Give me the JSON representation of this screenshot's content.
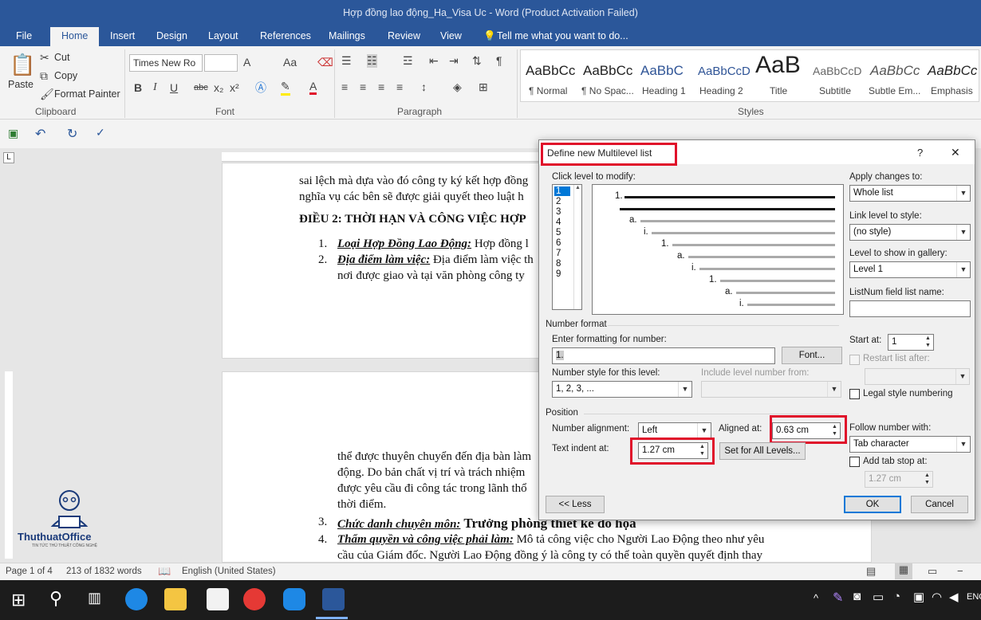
{
  "window": {
    "title": "Hợp đồng lao động_Ha_Visa Uc - Word (Product Activation Failed)"
  },
  "tabs": [
    "File",
    "Home",
    "Insert",
    "Design",
    "Layout",
    "References",
    "Mailings",
    "Review",
    "View"
  ],
  "tell_me": "Tell me what you want to do...",
  "clipboard": {
    "paste": "Paste",
    "cut": "Cut",
    "copy": "Copy",
    "format_painter": "Format Painter",
    "label": "Clipboard"
  },
  "font": {
    "name": "Times New Ro",
    "size": "",
    "label": "Font",
    "bold": "B",
    "italic": "I",
    "underline": "U",
    "strike": "abc",
    "sub": "x₂",
    "sup": "x²",
    "font_color": "A",
    "grow": "A",
    "case": "Aa"
  },
  "paragraph": {
    "label": "Paragraph"
  },
  "styles": {
    "label": "Styles",
    "items": [
      {
        "preview": "AaBbCc",
        "name": "¶ Normal"
      },
      {
        "preview": "AaBbCc",
        "name": "¶ No Spac..."
      },
      {
        "preview": "AaBbC",
        "name": "Heading 1"
      },
      {
        "preview": "AaBbCcD",
        "name": "Heading 2"
      },
      {
        "preview": "AaB",
        "name": "Title"
      },
      {
        "preview": "AaBbCcD",
        "name": "Subtitle"
      },
      {
        "preview": "AaBbCc",
        "name": "Subtle Em..."
      },
      {
        "preview": "AaBbCc",
        "name": "Emphasis"
      }
    ]
  },
  "doc": {
    "page1": [
      "sai lệch mà dựa vào đó công ty ký kết hợp đồng",
      "nghĩa vụ các bên sẽ được giải quyết theo luật h"
    ],
    "heading": "ĐIỀU 2: THỜI HẠN VÀ CÔNG VIỆC HỢP",
    "item1_num": "1.",
    "item1_label": "Loại Hợp Đồng Lao Động:",
    "item1_text": " Hợp đồng l",
    "item2_num": "2.",
    "item2_label": "Địa điểm làm việc:",
    "item2_text": " Địa điểm làm việc th",
    "item2_cont": "nơi được giao và tại văn phòng công ty",
    "page2": [
      "thể được thuyên chuyển đến địa bàn làm",
      "động. Do bản chất vị trí và trách nhiệm",
      "được yêu cầu đi công tác trong lãnh thổ",
      "thời điểm."
    ],
    "item3_num": "3.",
    "item3_label": "Chức danh chuyên môn:",
    "item3_text": " Trưởng phòng thiết kế đồ họa",
    "item4_num": "4.",
    "item4_label": "Thẩm quyền và công việc phải làm:",
    "item4_text": " Mô tả công việc cho Người Lao Động theo như yêu",
    "item4_cont": "cầu của Giám đốc. Người Lao Động đồng ý là công ty có thể toàn quyền quyết định thay"
  },
  "watermark": {
    "brand": "ThuthuatOffice",
    "tag": "TIN TỨC THỦ THUẬT CÔNG NGHỆ"
  },
  "status": {
    "page": "Page 1 of 4",
    "words": "213 of 1832 words",
    "language": "English (United States)"
  },
  "taskbar": {
    "lang": "ENG"
  },
  "dialog": {
    "title": "Define new Multilevel list",
    "help": "?",
    "close": "✕",
    "click_level": "Click level to modify:",
    "levels": [
      "1",
      "2",
      "3",
      "4",
      "5",
      "6",
      "7",
      "8",
      "9"
    ],
    "preview_labels": [
      "1.",
      "a.",
      "i.",
      "1.",
      "a.",
      "i.",
      "1.",
      "a.",
      "i."
    ],
    "apply_to_label": "Apply changes to:",
    "apply_to": "Whole list",
    "link_style_label": "Link level to style:",
    "link_style": "(no style)",
    "gallery_label": "Level to show in gallery:",
    "gallery": "Level 1",
    "listnum_label": "ListNum field list name:",
    "listnum": "",
    "number_format": "Number format",
    "enter_format_label": "Enter formatting for number:",
    "enter_format": "1.",
    "font_btn": "Font...",
    "style_label": "Number style for this level:",
    "style_value": "1, 2, 3, ...",
    "include_label": "Include level number from:",
    "start_at_label": "Start at:",
    "start_at": "1",
    "restart_label": "Restart list after:",
    "legal_label": "Legal style numbering",
    "position": "Position",
    "alignment_label": "Number alignment:",
    "alignment": "Left",
    "aligned_at_label": "Aligned at:",
    "aligned_at": "0.63 cm",
    "indent_label": "Text indent at:",
    "indent": "1.27 cm",
    "set_all": "Set for All Levels...",
    "follow_label": "Follow number with:",
    "follow": "Tab character",
    "tab_stop_label": "Add tab stop at:",
    "tab_stop": "1.27 cm",
    "less": "<< Less",
    "ok": "OK",
    "cancel": "Cancel"
  }
}
